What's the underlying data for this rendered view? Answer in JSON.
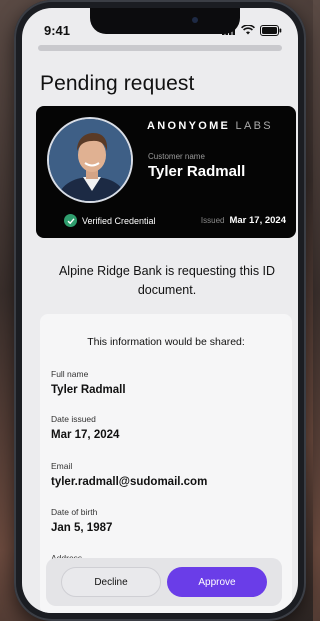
{
  "status_bar": {
    "time": "9:41"
  },
  "page_title": "Pending request",
  "credential": {
    "brand_bold": "ANONYOME",
    "brand_light": " LABS",
    "customer_label": "Customer name",
    "customer_name": "Tyler Radmall",
    "verified_label": "Verified Credential",
    "issued_label": "Issued",
    "issued_date": "Mar 17, 2024"
  },
  "request_text": "Alpine Ridge Bank is requesting this ID document.",
  "info": {
    "heading": "This information would be shared:",
    "fields": [
      {
        "label": "Full name",
        "value": "Tyler Radmall"
      },
      {
        "label": "Date issued",
        "value": "Mar 17, 2024"
      },
      {
        "label": "Email",
        "value": "tyler.radmall@sudomail.com"
      },
      {
        "label": "Date of birth",
        "value": "Jan 5, 1987"
      },
      {
        "label": "Address",
        "value": ""
      }
    ]
  },
  "actions": {
    "decline": "Decline",
    "approve": "Approve"
  },
  "colors": {
    "accent": "#6a3de8",
    "verified": "#2f9e6e",
    "card_bg": "#050505"
  },
  "icons": [
    "cellular-icon",
    "wifi-icon",
    "battery-icon",
    "check-circle-icon"
  ]
}
